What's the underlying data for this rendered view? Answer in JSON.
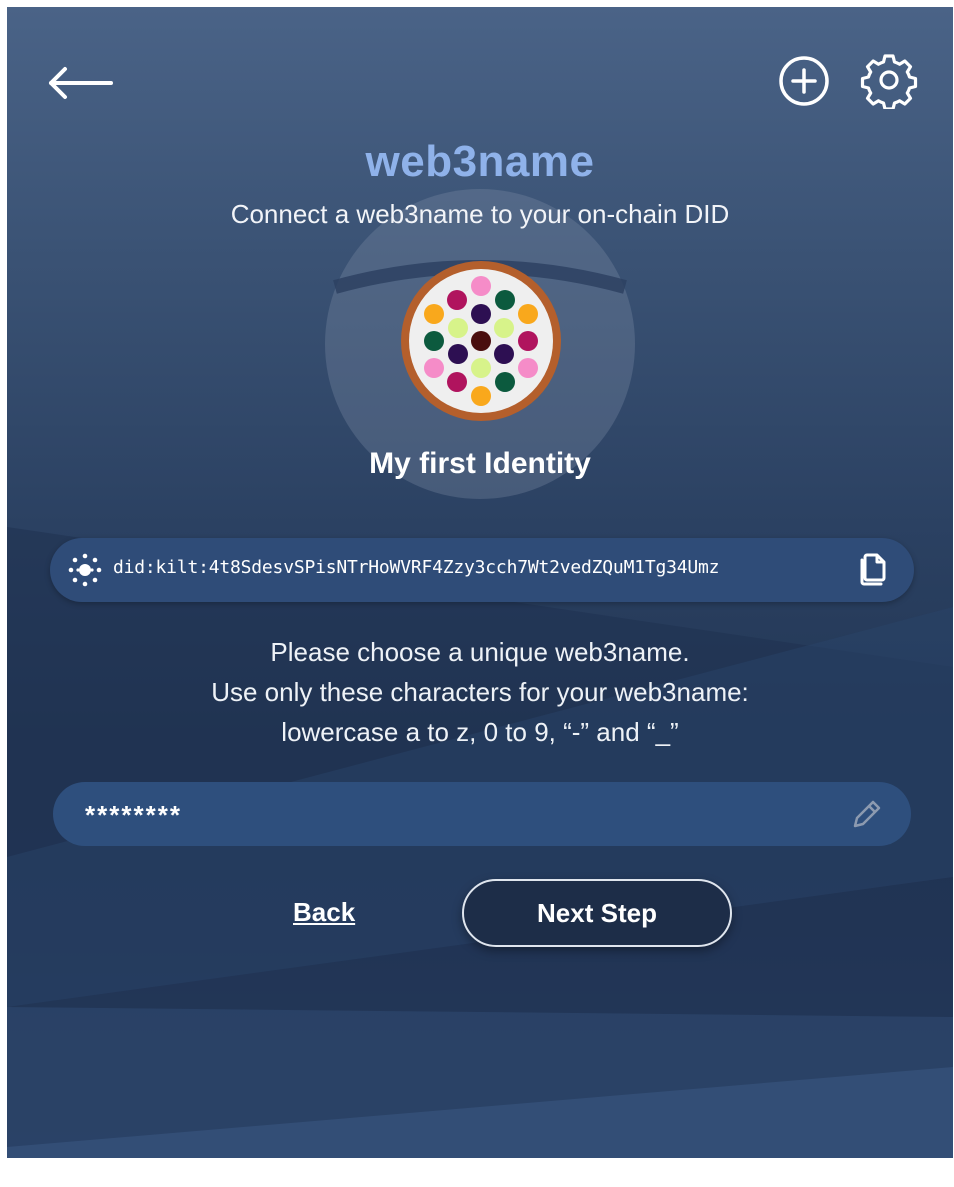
{
  "header": {
    "back_icon": "arrow-left-icon",
    "add_icon": "plus-circle-icon",
    "settings_icon": "gear-icon"
  },
  "page": {
    "title": "web3name",
    "subtitle": "Connect a web3name to your on-chain DID"
  },
  "identity": {
    "name": "My first Identity",
    "did": "did:kilt:4t8SdesvSPisNTrHoWVRF4Zzy3cch7Wt2vedZQuM1Tg34Umz",
    "did_icon": "kilt-logo-icon",
    "copy_icon": "copy-icon"
  },
  "instructions": {
    "line1": "Please choose a unique web3name.",
    "line2": "Use only these characters for your web3name:",
    "line3": "lowercase a to z, 0 to 9, “-” and “_”"
  },
  "form": {
    "web3name_value": "********",
    "edit_icon": "pencil-icon"
  },
  "actions": {
    "back_label": "Back",
    "next_label": "Next Step"
  },
  "colors": {
    "accent": "#8fb2ea",
    "background_top": "#4a6387",
    "background_bottom": "#223654",
    "pill": "#2f4c78"
  }
}
